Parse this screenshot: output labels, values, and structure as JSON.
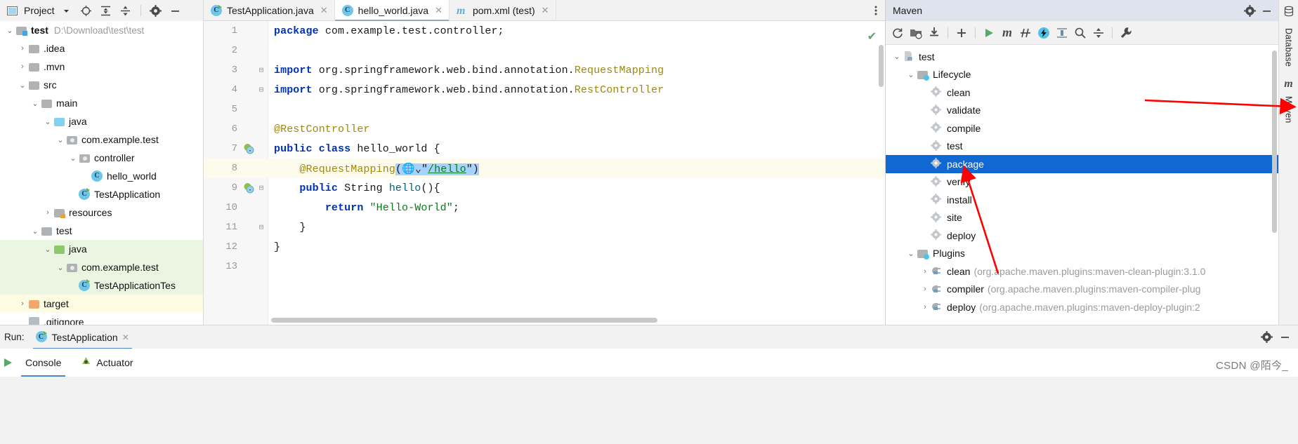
{
  "window": {
    "project_tool_title": "Project",
    "maven_tool_title": "Maven",
    "watermark": "CSDN @陌今_"
  },
  "project_toolbar": {
    "dropdown_icon": "chevron-down-icon",
    "locate_icon": "crosshair-target-icon",
    "expand_all_icon": "expand-all-icon",
    "collapse_all_icon": "collapse-all-icon",
    "settings_icon": "gear-icon",
    "hide_icon": "minimize-icon"
  },
  "project_tree": [
    {
      "label": "test",
      "path": "D:\\Download\\test\\test",
      "icon": "module-folder-icon",
      "arrow": "expanded",
      "indent": 0,
      "bold": true,
      "highlight": "none"
    },
    {
      "label": ".idea",
      "path": "",
      "icon": "folder-icon",
      "arrow": "collapsed",
      "indent": 1,
      "bold": false,
      "highlight": "none"
    },
    {
      "label": ".mvn",
      "path": "",
      "icon": "folder-icon",
      "arrow": "collapsed",
      "indent": 1,
      "bold": false,
      "highlight": "none"
    },
    {
      "label": "src",
      "path": "",
      "icon": "folder-icon",
      "arrow": "expanded",
      "indent": 1,
      "bold": false,
      "highlight": "none"
    },
    {
      "label": "main",
      "path": "",
      "icon": "folder-icon",
      "arrow": "expanded",
      "indent": 2,
      "bold": false,
      "highlight": "none"
    },
    {
      "label": "java",
      "path": "",
      "icon": "source-folder-icon",
      "arrow": "expanded",
      "indent": 3,
      "bold": false,
      "highlight": "none"
    },
    {
      "label": "com.example.test",
      "path": "",
      "icon": "package-folder-icon",
      "arrow": "expanded",
      "indent": 4,
      "bold": false,
      "highlight": "none"
    },
    {
      "label": "controller",
      "path": "",
      "icon": "package-folder-icon",
      "arrow": "expanded",
      "indent": 5,
      "bold": false,
      "highlight": "none"
    },
    {
      "label": "hello_world",
      "path": "",
      "icon": "java-class-icon",
      "arrow": "none",
      "indent": 6,
      "bold": false,
      "highlight": "none"
    },
    {
      "label": "TestApplication",
      "path": "",
      "icon": "spring-run-class-icon",
      "arrow": "none",
      "indent": 5,
      "bold": false,
      "highlight": "none"
    },
    {
      "label": "resources",
      "path": "",
      "icon": "resources-folder-icon",
      "arrow": "collapsed",
      "indent": 3,
      "bold": false,
      "highlight": "none"
    },
    {
      "label": "test",
      "path": "",
      "icon": "folder-icon",
      "arrow": "expanded",
      "indent": 2,
      "bold": false,
      "highlight": "none"
    },
    {
      "label": "java",
      "path": "",
      "icon": "test-source-folder-icon",
      "arrow": "expanded",
      "indent": 3,
      "bold": false,
      "highlight": "green"
    },
    {
      "label": "com.example.test",
      "path": "",
      "icon": "package-folder-icon",
      "arrow": "expanded",
      "indent": 4,
      "bold": false,
      "highlight": "green"
    },
    {
      "label": "TestApplicationTes",
      "path": "",
      "icon": "java-test-class-icon",
      "arrow": "none",
      "indent": 5,
      "bold": false,
      "highlight": "green"
    },
    {
      "label": "target",
      "path": "",
      "icon": "excluded-folder-icon",
      "arrow": "collapsed",
      "indent": 1,
      "bold": false,
      "highlight": "yellow"
    },
    {
      "label": ".gitignore",
      "path": "",
      "icon": "gitignore-file-icon",
      "arrow": "none",
      "indent": 1,
      "bold": false,
      "highlight": "none"
    }
  ],
  "editor_tabs": [
    {
      "label": "TestApplication.java",
      "icon": "spring-run-class-icon",
      "active": false,
      "close_icon": "close-icon"
    },
    {
      "label": "hello_world.java",
      "icon": "java-class-icon",
      "active": true,
      "close_icon": "close-icon"
    },
    {
      "label": "pom.xml (test)",
      "icon": "maven-m-icon",
      "active": false,
      "close_icon": "close-icon"
    }
  ],
  "editor": {
    "kebab_icon": "more-options-icon",
    "inspection_ok_icon": "checkmark-icon",
    "lines": [
      {
        "n": "1",
        "fold": "",
        "gutter": "",
        "current": false,
        "tokens": [
          {
            "t": "package",
            "c": "kw"
          },
          {
            "t": " com.example.test.controller;",
            "c": ""
          }
        ]
      },
      {
        "n": "2",
        "fold": "",
        "gutter": "",
        "current": false,
        "tokens": []
      },
      {
        "n": "3",
        "fold": "⊟",
        "gutter": "",
        "current": false,
        "tokens": [
          {
            "t": "import",
            "c": "kw"
          },
          {
            "t": " org.springframework.web.bind.annotation.",
            "c": ""
          },
          {
            "t": "RequestMapping",
            "c": "ann"
          }
        ]
      },
      {
        "n": "4",
        "fold": "⊟",
        "gutter": "",
        "current": false,
        "tokens": [
          {
            "t": "import",
            "c": "kw"
          },
          {
            "t": " org.springframework.web.bind.annotation.",
            "c": ""
          },
          {
            "t": "RestController",
            "c": "ann"
          }
        ]
      },
      {
        "n": "5",
        "fold": "",
        "gutter": "",
        "current": false,
        "tokens": []
      },
      {
        "n": "6",
        "fold": "",
        "gutter": "",
        "current": false,
        "tokens": [
          {
            "t": "@RestController",
            "c": "ann"
          }
        ]
      },
      {
        "n": "7",
        "fold": "",
        "gutter": "spring-bean-icon",
        "current": false,
        "tokens": [
          {
            "t": "public",
            "c": "kw"
          },
          {
            "t": " ",
            "c": ""
          },
          {
            "t": "class",
            "c": "kw"
          },
          {
            "t": " hello_world {",
            "c": ""
          }
        ]
      },
      {
        "n": "8",
        "fold": "",
        "gutter": "",
        "current": true,
        "tokens": [
          {
            "t": "    ",
            "c": ""
          },
          {
            "t": "@RequestMapping",
            "c": "ann"
          },
          {
            "t": "(",
            "c": "sel"
          },
          {
            "t": "🌐",
            "c": "sel"
          },
          {
            "t": "⌄",
            "c": "sel"
          },
          {
            "t": "\"",
            "c": "sel"
          },
          {
            "t": "/hello",
            "c": "sel-link"
          },
          {
            "t": "\")",
            "c": "sel"
          }
        ]
      },
      {
        "n": "9",
        "fold": "⊟",
        "gutter": "spring-mapping-icon",
        "current": false,
        "tokens": [
          {
            "t": "    ",
            "c": ""
          },
          {
            "t": "public",
            "c": "kw"
          },
          {
            "t": " String ",
            "c": ""
          },
          {
            "t": "hello",
            "c": "meth"
          },
          {
            "t": "(){",
            "c": ""
          }
        ]
      },
      {
        "n": "10",
        "fold": "",
        "gutter": "",
        "current": false,
        "tokens": [
          {
            "t": "        ",
            "c": ""
          },
          {
            "t": "return",
            "c": "kw"
          },
          {
            "t": " ",
            "c": ""
          },
          {
            "t": "\"Hello-World\"",
            "c": "str"
          },
          {
            "t": ";",
            "c": ""
          }
        ]
      },
      {
        "n": "11",
        "fold": "⊟",
        "gutter": "",
        "current": false,
        "tokens": [
          {
            "t": "    }",
            "c": ""
          }
        ]
      },
      {
        "n": "12",
        "fold": "",
        "gutter": "",
        "current": false,
        "tokens": [
          {
            "t": "}",
            "c": ""
          }
        ]
      },
      {
        "n": "13",
        "fold": "",
        "gutter": "",
        "current": false,
        "tokens": []
      }
    ]
  },
  "maven": {
    "title": "Maven",
    "settings_icon": "gear-icon",
    "hide_icon": "minimize-icon",
    "toolbar": [
      {
        "icon": "reload-all-projects-icon",
        "name": "reload-all-maven-projects"
      },
      {
        "icon": "add-maven-project-icon",
        "name": "generate-sources"
      },
      {
        "icon": "download-sources-icon",
        "name": "download-sources"
      },
      {
        "icon": "plus-icon",
        "name": "add-maven-project"
      },
      {
        "icon": "run-icon",
        "name": "run-maven-build"
      },
      {
        "icon": "maven-m-icon",
        "name": "execute-maven-goal"
      },
      {
        "icon": "toggle-skip-tests-icon",
        "name": "toggle-skip-tests"
      },
      {
        "icon": "toggle-offline-icon",
        "name": "toggle-offline-mode"
      },
      {
        "icon": "show-dependencies-icon",
        "name": "show-dependencies"
      },
      {
        "icon": "search-icon",
        "name": "search-everywhere"
      },
      {
        "icon": "collapse-all-icon",
        "name": "collapse-all"
      },
      {
        "icon": "wrench-icon",
        "name": "maven-settings"
      }
    ],
    "tree": [
      {
        "label": "test",
        "detail": "",
        "icon": "maven-project-icon",
        "arrow": "expanded",
        "indent": 0,
        "selected": false
      },
      {
        "label": "Lifecycle",
        "detail": "",
        "icon": "lifecycle-folder-icon",
        "arrow": "expanded",
        "indent": 1,
        "selected": false
      },
      {
        "label": "clean",
        "detail": "",
        "icon": "maven-goal-icon",
        "arrow": "none",
        "indent": 2,
        "selected": false
      },
      {
        "label": "validate",
        "detail": "",
        "icon": "maven-goal-icon",
        "arrow": "none",
        "indent": 2,
        "selected": false
      },
      {
        "label": "compile",
        "detail": "",
        "icon": "maven-goal-icon",
        "arrow": "none",
        "indent": 2,
        "selected": false
      },
      {
        "label": "test",
        "detail": "",
        "icon": "maven-goal-icon",
        "arrow": "none",
        "indent": 2,
        "selected": false
      },
      {
        "label": "package",
        "detail": "",
        "icon": "maven-goal-icon",
        "arrow": "none",
        "indent": 2,
        "selected": true
      },
      {
        "label": "verify",
        "detail": "",
        "icon": "maven-goal-icon",
        "arrow": "none",
        "indent": 2,
        "selected": false
      },
      {
        "label": "install",
        "detail": "",
        "icon": "maven-goal-icon",
        "arrow": "none",
        "indent": 2,
        "selected": false
      },
      {
        "label": "site",
        "detail": "",
        "icon": "maven-goal-icon",
        "arrow": "none",
        "indent": 2,
        "selected": false
      },
      {
        "label": "deploy",
        "detail": "",
        "icon": "maven-goal-icon",
        "arrow": "none",
        "indent": 2,
        "selected": false
      },
      {
        "label": "Plugins",
        "detail": "",
        "icon": "plugins-folder-icon",
        "arrow": "expanded",
        "indent": 1,
        "selected": false
      },
      {
        "label": "clean",
        "detail": "(org.apache.maven.plugins:maven-clean-plugin:3.1.0",
        "icon": "maven-plugin-icon",
        "arrow": "collapsed",
        "indent": 2,
        "selected": false
      },
      {
        "label": "compiler",
        "detail": "(org.apache.maven.plugins:maven-compiler-plug",
        "icon": "maven-plugin-icon",
        "arrow": "collapsed",
        "indent": 2,
        "selected": false
      },
      {
        "label": "deploy",
        "detail": "(org.apache.maven.plugins:maven-deploy-plugin:2",
        "icon": "maven-plugin-icon",
        "arrow": "collapsed",
        "indent": 2,
        "selected": false
      }
    ]
  },
  "right_stripe": [
    {
      "label": "Database",
      "icon": "database-icon"
    },
    {
      "label": "Maven",
      "icon": "maven-m-icon"
    }
  ],
  "run_panel": {
    "run_label": "Run:",
    "config_tab": "TestApplication",
    "config_icon": "spring-run-class-icon",
    "close_icon": "close-icon",
    "settings_icon": "gear-icon",
    "hide_icon": "minimize-icon",
    "rerun_icon": "run-icon",
    "tabs": [
      {
        "label": "Console",
        "icon": "",
        "active": true
      },
      {
        "label": "Actuator",
        "icon": "actuator-icon",
        "active": false
      }
    ]
  }
}
